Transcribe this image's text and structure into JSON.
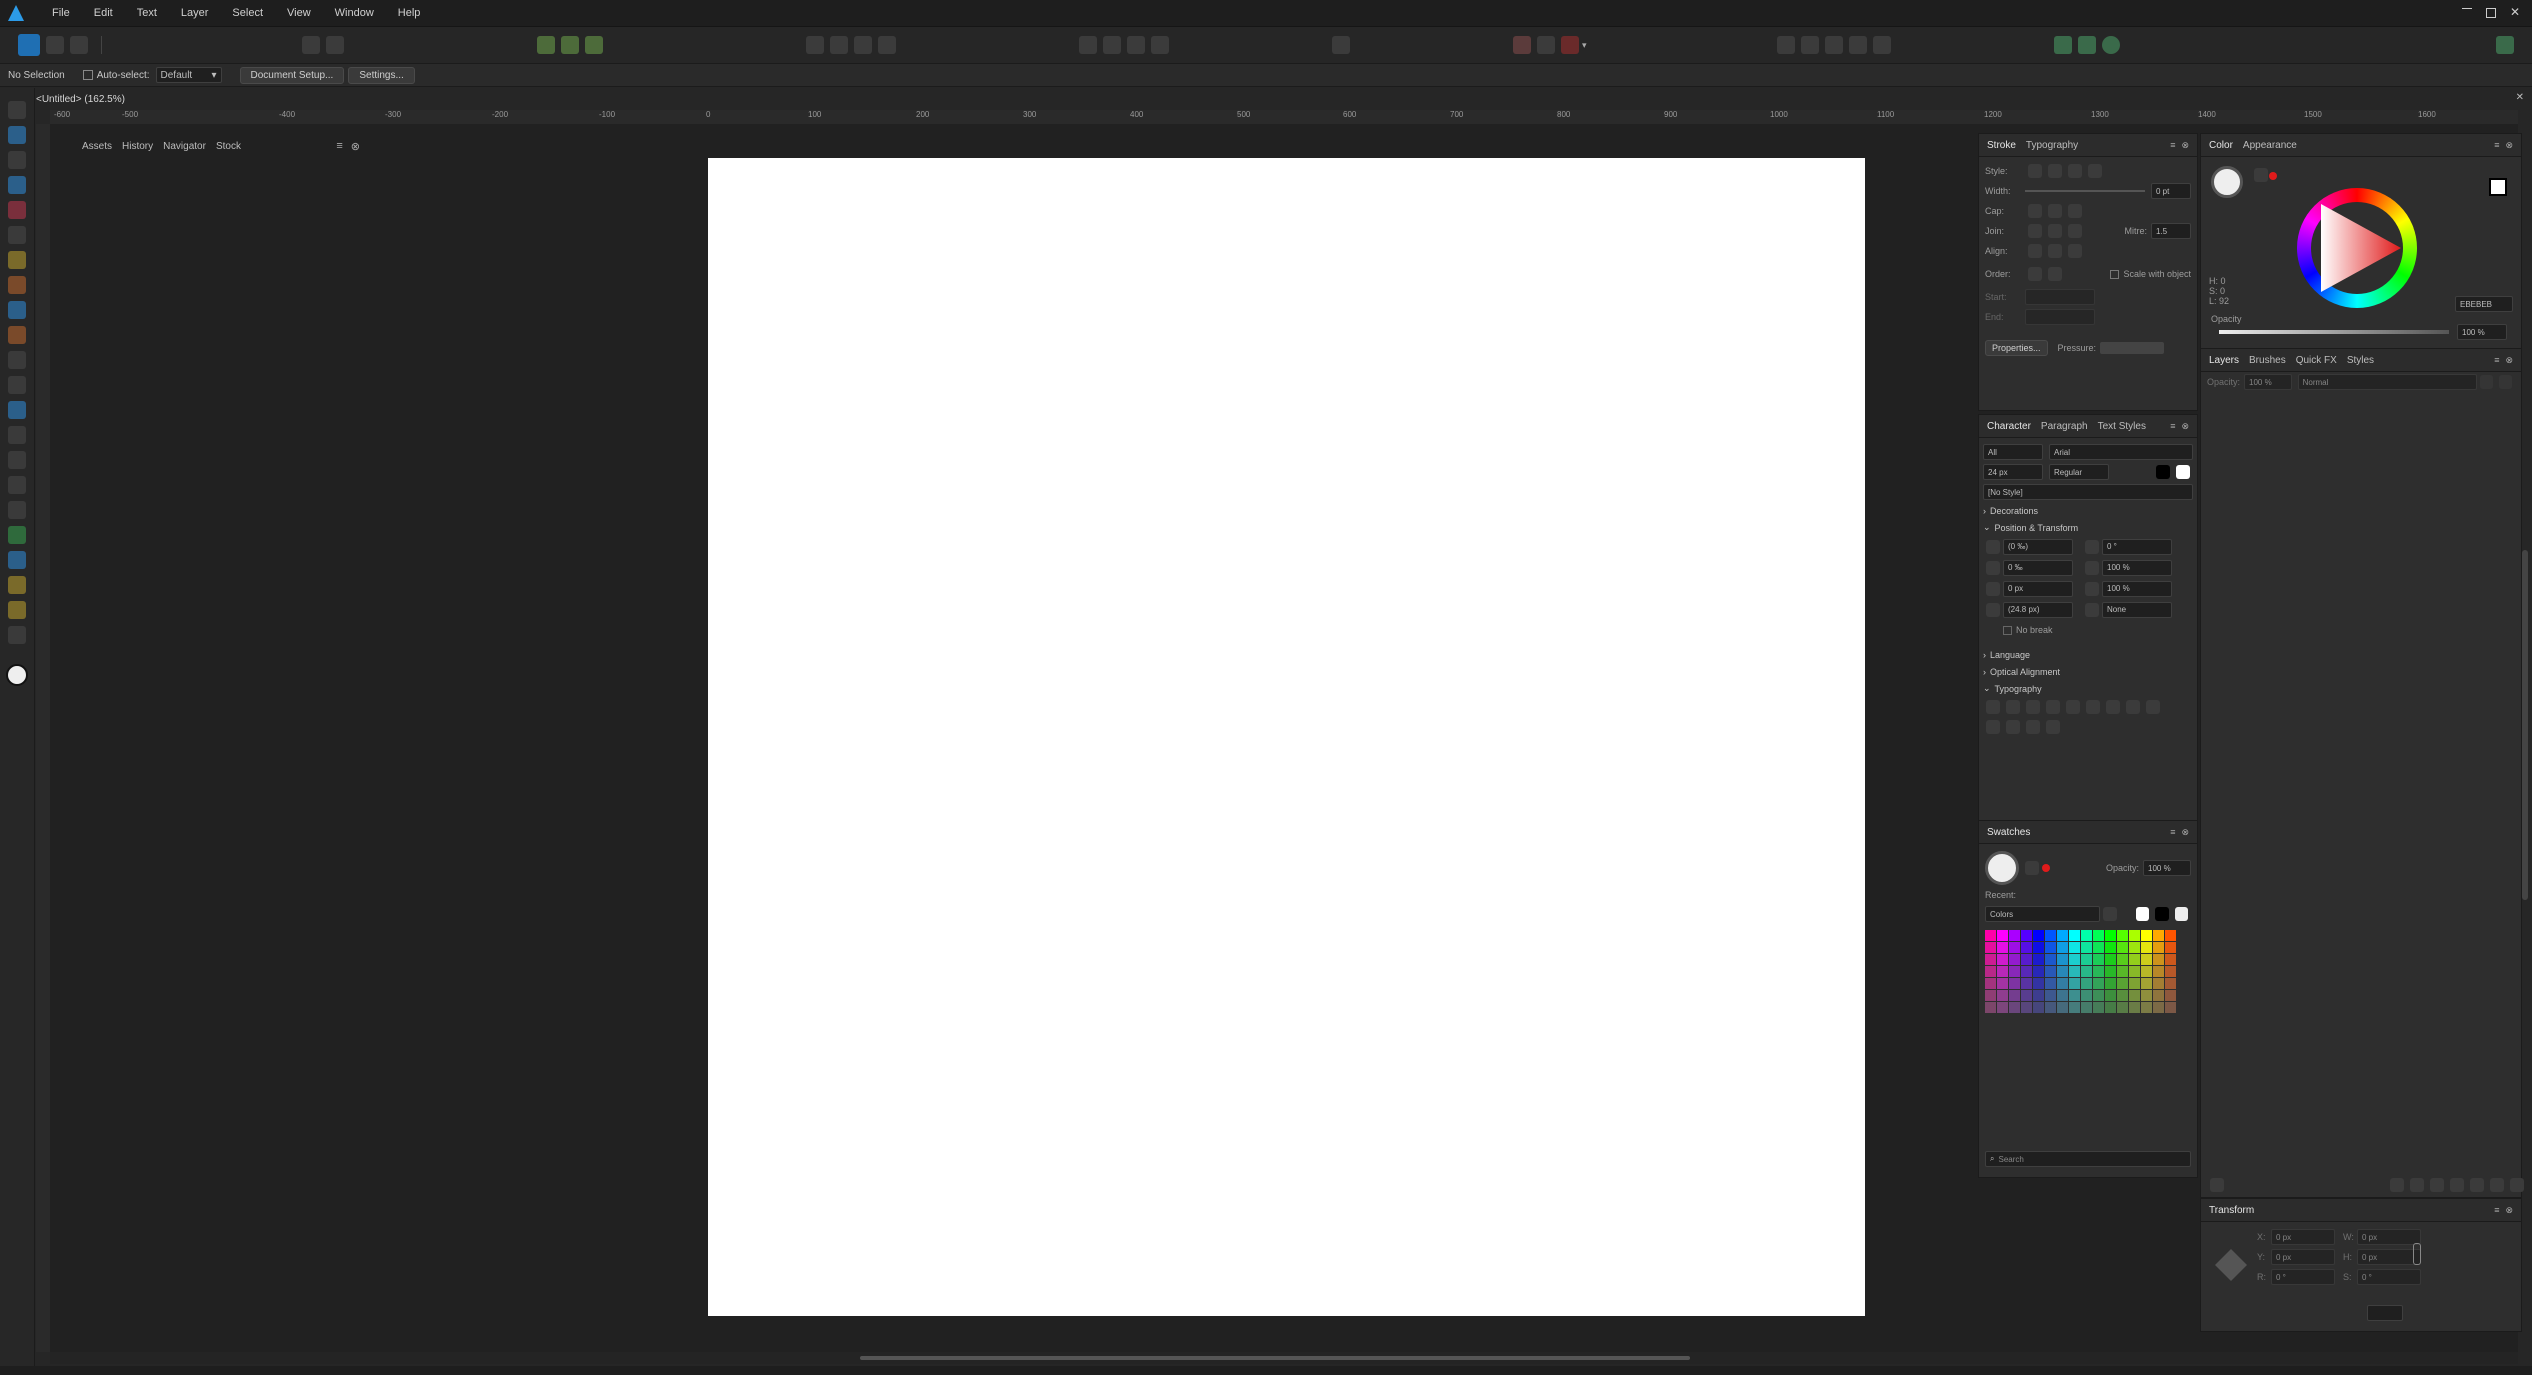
{
  "menu": [
    "File",
    "Edit",
    "Text",
    "Layer",
    "Select",
    "View",
    "Window",
    "Help"
  ],
  "context": {
    "selection": "No Selection",
    "auto_select_label": "Auto-select:",
    "auto_select_value": "Default",
    "document_setup": "Document Setup...",
    "settings": "Settings..."
  },
  "document_tab": "<Untitled> (162.5%)",
  "ruler_labels": [
    "-600",
    "-500",
    "-400",
    "-300",
    "-200",
    "-100",
    "0",
    "100",
    "200",
    "300",
    "400",
    "500",
    "600",
    "700",
    "800",
    "900",
    "1000",
    "1100",
    "1200",
    "1300",
    "1400",
    "1500",
    "1600"
  ],
  "left_panel_tabs": [
    "Assets",
    "History",
    "Navigator",
    "Stock"
  ],
  "stroke": {
    "tabs": [
      "Stroke",
      "Typography"
    ],
    "style_label": "Style:",
    "width_label": "Width:",
    "width_value": "0 pt",
    "cap_label": "Cap:",
    "join_label": "Join:",
    "mitre_label": "Mitre:",
    "mitre_value": "1.5",
    "align_label": "Align:",
    "order_label": "Order:",
    "scale_with_object": "Scale with object",
    "start_label": "Start:",
    "end_label": "End:",
    "properties": "Properties...",
    "pressure_label": "Pressure:"
  },
  "color": {
    "tabs": [
      "Color",
      "Appearance"
    ],
    "hsl": [
      "H: 0",
      "S: 0",
      "L: 92"
    ],
    "hex": "EBEBEB",
    "opacity_label": "Opacity",
    "opacity_value": "100 %"
  },
  "layers": {
    "tabs": [
      "Layers",
      "Brushes",
      "Quick FX",
      "Styles"
    ],
    "opacity_label": "Opacity:",
    "opacity_value": "100 %",
    "blend": "Normal"
  },
  "character": {
    "tabs": [
      "Character",
      "Paragraph",
      "Text Styles"
    ],
    "scope": "All",
    "font": "Arial",
    "size": "24 px",
    "weight": "Regular",
    "style": "[No Style]",
    "sections": [
      "Decorations",
      "Position & Transform"
    ],
    "fields_left": [
      "(0 ‰)",
      "0 ‰",
      "0 px",
      "(24.8 px)"
    ],
    "fields_right": [
      "0 °",
      "100 %",
      "100 %",
      "None"
    ],
    "no_break": "No break",
    "sections2": [
      "Language",
      "Optical Alignment",
      "Typography"
    ]
  },
  "swatches": {
    "title": "Swatches",
    "opacity_label": "Opacity:",
    "opacity_value": "100 %",
    "recent_label": "Recent:",
    "palette": "Colors",
    "search_placeholder": "Search"
  },
  "transform": {
    "title": "Transform",
    "x_label": "X:",
    "x": "0 px",
    "y_label": "Y:",
    "y": "0 px",
    "w_label": "W:",
    "w": "0 px",
    "h_label": "H:",
    "h": "0 px",
    "r_label": "R:",
    "r": "0 °",
    "s_label": "S:",
    "s": "0 °"
  }
}
